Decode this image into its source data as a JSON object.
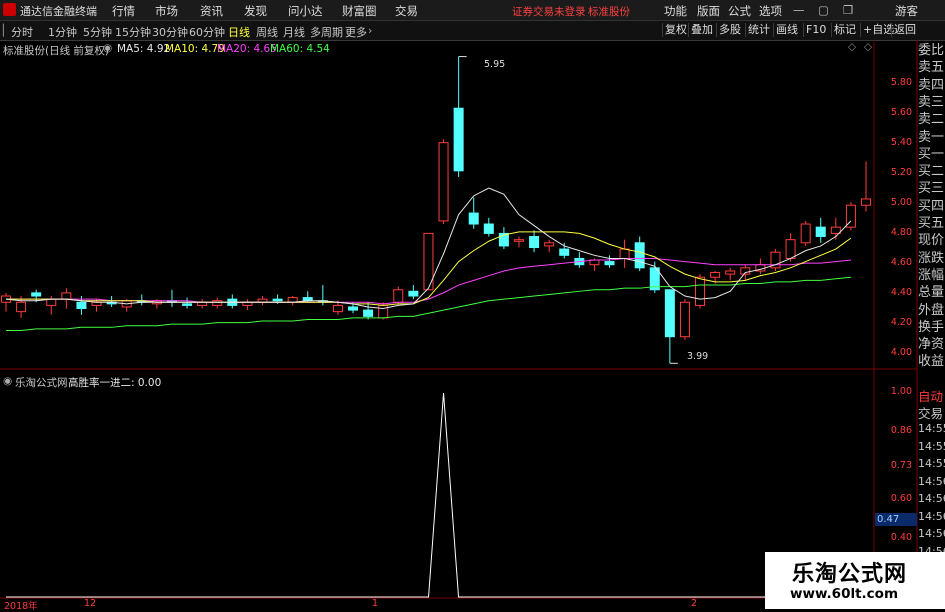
{
  "titlebar": {
    "app_name": "通达信金融终端",
    "menu": [
      "行情",
      "市场",
      "资讯",
      "发现",
      "问小达",
      "财富圈",
      "交易"
    ],
    "warning": "证券交易未登录",
    "stock_name": "标准股份",
    "right_menu": [
      "功能",
      "版面",
      "公式",
      "选项"
    ],
    "guest": "游客"
  },
  "periods": {
    "items": [
      "分时",
      "1分钟",
      "5分钟",
      "15分钟",
      "30分钟",
      "60分钟",
      "日线",
      "周线",
      "月线",
      "多周期",
      "更多"
    ],
    "active": "日线"
  },
  "toolbar_right": [
    "复权",
    "叠加",
    "多股",
    "统计",
    "画线",
    "F10",
    "标记",
    "+自选",
    "返回"
  ],
  "main_chart": {
    "title": "标准股份(日线 前复权)",
    "ma": [
      {
        "label": "MA5: 4.92",
        "color": "#e8e8e8"
      },
      {
        "label": "MA10: 4.79",
        "color": "#ffff40"
      },
      {
        "label": "MA20: 4.65",
        "color": "#ff40ff"
      },
      {
        "label": "MA60: 4.54",
        "color": "#40ff40"
      }
    ],
    "y_ticks": [
      "5.80",
      "5.60",
      "5.40",
      "5.20",
      "5.00",
      "4.80",
      "4.60",
      "4.40",
      "4.20",
      "4.00"
    ],
    "high_label": "5.95",
    "low_label": "3.99"
  },
  "indicator": {
    "title": "乐淘公式网",
    "name_value": "高胜率一进二: 0.00",
    "y_ticks": [
      "1.00",
      "0.86",
      "0.73",
      "0.60",
      "0.47",
      "0.40"
    ],
    "current_value": "0.47"
  },
  "dates": [
    "2018年",
    "12",
    "1",
    "2"
  ],
  "side_panel": {
    "labels": [
      "委比",
      "卖五",
      "卖四",
      "卖三",
      "卖二",
      "卖一",
      "买一",
      "买二",
      "买三",
      "买四",
      "买五",
      "现价",
      "涨跌",
      "涨幅",
      "总量",
      "外盘",
      "换手",
      "净资",
      "收益"
    ],
    "auto": "自动",
    "trade": "交易",
    "times": [
      "14:55",
      "14:55",
      "14:55",
      "14:56",
      "14:56",
      "14:56",
      "14:56",
      "14:56"
    ]
  },
  "watermark": {
    "line1": "乐淘公式网",
    "line2": "www.60lt.com"
  },
  "chart_data": [
    {
      "type": "candlestick",
      "title": "标准股份(日线 前复权)",
      "ylim": [
        3.96,
        5.96
      ],
      "candles": [
        {
          "o": 4.38,
          "h": 4.44,
          "l": 4.32,
          "c": 4.42
        },
        {
          "o": 4.32,
          "h": 4.42,
          "l": 4.28,
          "c": 4.38
        },
        {
          "o": 4.44,
          "h": 4.46,
          "l": 4.38,
          "c": 4.42
        },
        {
          "o": 4.36,
          "h": 4.42,
          "l": 4.3,
          "c": 4.4
        },
        {
          "o": 4.4,
          "h": 4.47,
          "l": 4.34,
          "c": 4.44
        },
        {
          "o": 4.38,
          "h": 4.42,
          "l": 4.3,
          "c": 4.34
        },
        {
          "o": 4.36,
          "h": 4.4,
          "l": 4.32,
          "c": 4.38
        },
        {
          "o": 4.38,
          "h": 4.42,
          "l": 4.35,
          "c": 4.37
        },
        {
          "o": 4.35,
          "h": 4.4,
          "l": 4.32,
          "c": 4.39
        },
        {
          "o": 4.39,
          "h": 4.43,
          "l": 4.36,
          "c": 4.38
        },
        {
          "o": 4.37,
          "h": 4.4,
          "l": 4.34,
          "c": 4.39
        },
        {
          "o": 4.39,
          "h": 4.46,
          "l": 4.35,
          "c": 4.38
        },
        {
          "o": 4.37,
          "h": 4.41,
          "l": 4.34,
          "c": 4.36
        },
        {
          "o": 4.36,
          "h": 4.4,
          "l": 4.34,
          "c": 4.38
        },
        {
          "o": 4.36,
          "h": 4.41,
          "l": 4.34,
          "c": 4.39
        },
        {
          "o": 4.4,
          "h": 4.43,
          "l": 4.34,
          "c": 4.36
        },
        {
          "o": 4.36,
          "h": 4.4,
          "l": 4.33,
          "c": 4.38
        },
        {
          "o": 4.38,
          "h": 4.42,
          "l": 4.36,
          "c": 4.4
        },
        {
          "o": 4.4,
          "h": 4.43,
          "l": 4.37,
          "c": 4.39
        },
        {
          "o": 4.38,
          "h": 4.42,
          "l": 4.36,
          "c": 4.41
        },
        {
          "o": 4.41,
          "h": 4.45,
          "l": 4.38,
          "c": 4.39
        },
        {
          "o": 4.39,
          "h": 4.49,
          "l": 4.36,
          "c": 4.38
        },
        {
          "o": 4.32,
          "h": 4.39,
          "l": 4.3,
          "c": 4.36
        },
        {
          "o": 4.35,
          "h": 4.38,
          "l": 4.31,
          "c": 4.33
        },
        {
          "o": 4.33,
          "h": 4.38,
          "l": 4.27,
          "c": 4.29
        },
        {
          "o": 4.28,
          "h": 4.38,
          "l": 4.27,
          "c": 4.36
        },
        {
          "o": 4.38,
          "h": 4.48,
          "l": 4.36,
          "c": 4.46
        },
        {
          "o": 4.45,
          "h": 4.49,
          "l": 4.4,
          "c": 4.42
        },
        {
          "o": 4.46,
          "h": 4.82,
          "l": 4.46,
          "c": 4.82
        },
        {
          "o": 4.9,
          "h": 5.42,
          "l": 4.88,
          "c": 5.4
        },
        {
          "o": 5.62,
          "h": 5.95,
          "l": 5.18,
          "c": 5.22
        },
        {
          "o": 4.95,
          "h": 5.05,
          "l": 4.85,
          "c": 4.88
        },
        {
          "o": 4.88,
          "h": 4.92,
          "l": 4.8,
          "c": 4.82
        },
        {
          "o": 4.82,
          "h": 4.86,
          "l": 4.72,
          "c": 4.74
        },
        {
          "o": 4.77,
          "h": 4.8,
          "l": 4.73,
          "c": 4.78
        },
        {
          "o": 4.8,
          "h": 4.84,
          "l": 4.7,
          "c": 4.73
        },
        {
          "o": 4.74,
          "h": 4.78,
          "l": 4.7,
          "c": 4.76
        },
        {
          "o": 4.72,
          "h": 4.76,
          "l": 4.66,
          "c": 4.68
        },
        {
          "o": 4.66,
          "h": 4.7,
          "l": 4.6,
          "c": 4.62
        },
        {
          "o": 4.62,
          "h": 4.66,
          "l": 4.58,
          "c": 4.65
        },
        {
          "o": 4.64,
          "h": 4.68,
          "l": 4.6,
          "c": 4.62
        },
        {
          "o": 4.66,
          "h": 4.78,
          "l": 4.6,
          "c": 4.72
        },
        {
          "o": 4.76,
          "h": 4.8,
          "l": 4.58,
          "c": 4.6
        },
        {
          "o": 4.6,
          "h": 4.64,
          "l": 4.44,
          "c": 4.46
        },
        {
          "o": 4.46,
          "h": 4.46,
          "l": 3.99,
          "c": 4.16
        },
        {
          "o": 4.16,
          "h": 4.4,
          "l": 4.14,
          "c": 4.38
        },
        {
          "o": 4.36,
          "h": 4.56,
          "l": 4.34,
          "c": 4.54
        },
        {
          "o": 4.54,
          "h": 4.58,
          "l": 4.5,
          "c": 4.57
        },
        {
          "o": 4.56,
          "h": 4.6,
          "l": 4.52,
          "c": 4.58
        },
        {
          "o": 4.56,
          "h": 4.62,
          "l": 4.52,
          "c": 4.6
        },
        {
          "o": 4.58,
          "h": 4.66,
          "l": 4.56,
          "c": 4.62
        },
        {
          "o": 4.6,
          "h": 4.72,
          "l": 4.58,
          "c": 4.7
        },
        {
          "o": 4.66,
          "h": 4.82,
          "l": 4.64,
          "c": 4.78
        },
        {
          "o": 4.76,
          "h": 4.9,
          "l": 4.74,
          "c": 4.88
        },
        {
          "o": 4.86,
          "h": 4.92,
          "l": 4.76,
          "c": 4.8
        },
        {
          "o": 4.82,
          "h": 4.92,
          "l": 4.78,
          "c": 4.86
        },
        {
          "o": 4.86,
          "h": 5.02,
          "l": 4.84,
          "c": 5.0
        },
        {
          "o": 5.0,
          "h": 5.28,
          "l": 4.96,
          "c": 5.04
        }
      ],
      "ma5": [
        4.4,
        4.39,
        4.39,
        4.4,
        4.4,
        4.39,
        4.38,
        4.38,
        4.37,
        4.38,
        4.38,
        4.38,
        4.38,
        4.38,
        4.38,
        4.38,
        4.38,
        4.38,
        4.38,
        4.38,
        4.39,
        4.39,
        4.38,
        4.37,
        4.35,
        4.34,
        4.36,
        4.37,
        4.47,
        4.69,
        4.94,
        5.06,
        5.11,
        5.07,
        4.94,
        4.87,
        4.8,
        4.74,
        4.71,
        4.68,
        4.66,
        4.66,
        4.64,
        4.61,
        4.48,
        4.42,
        4.4,
        4.41,
        4.45,
        4.57,
        4.59,
        4.62,
        4.66,
        4.71,
        4.74,
        4.8,
        4.9
      ],
      "ma10": [
        4.4,
        4.4,
        4.4,
        4.4,
        4.4,
        4.39,
        4.39,
        4.39,
        4.39,
        4.39,
        4.38,
        4.38,
        4.38,
        4.38,
        4.38,
        4.38,
        4.38,
        4.38,
        4.38,
        4.38,
        4.38,
        4.38,
        4.38,
        4.37,
        4.37,
        4.36,
        4.37,
        4.37,
        4.41,
        4.52,
        4.64,
        4.71,
        4.77,
        4.81,
        4.83,
        4.83,
        4.83,
        4.83,
        4.82,
        4.79,
        4.75,
        4.72,
        4.7,
        4.67,
        4.61,
        4.56,
        4.53,
        4.51,
        4.51,
        4.52,
        4.55,
        4.57,
        4.6,
        4.64,
        4.68,
        4.72,
        4.79
      ],
      "ma20": [
        4.4,
        4.4,
        4.4,
        4.4,
        4.4,
        4.4,
        4.4,
        4.39,
        4.39,
        4.39,
        4.39,
        4.39,
        4.39,
        4.38,
        4.38,
        4.38,
        4.38,
        4.38,
        4.38,
        4.38,
        4.38,
        4.38,
        4.38,
        4.38,
        4.38,
        4.37,
        4.38,
        4.38,
        4.4,
        4.44,
        4.49,
        4.52,
        4.55,
        4.58,
        4.6,
        4.61,
        4.62,
        4.63,
        4.64,
        4.65,
        4.65,
        4.66,
        4.66,
        4.66,
        4.65,
        4.64,
        4.63,
        4.62,
        4.62,
        4.62,
        4.62,
        4.62,
        4.62,
        4.63,
        4.63,
        4.64,
        4.65
      ],
      "ma60": [
        4.2,
        4.2,
        4.21,
        4.21,
        4.21,
        4.22,
        4.22,
        4.22,
        4.23,
        4.23,
        4.23,
        4.24,
        4.24,
        4.24,
        4.25,
        4.25,
        4.25,
        4.26,
        4.26,
        4.26,
        4.27,
        4.27,
        4.27,
        4.28,
        4.28,
        4.28,
        4.29,
        4.29,
        4.31,
        4.33,
        4.35,
        4.37,
        4.39,
        4.4,
        4.41,
        4.42,
        4.43,
        4.44,
        4.45,
        4.46,
        4.46,
        4.47,
        4.47,
        4.48,
        4.48,
        4.48,
        4.49,
        4.49,
        4.49,
        4.5,
        4.5,
        4.51,
        4.51,
        4.52,
        4.52,
        4.53,
        4.54
      ]
    },
    {
      "type": "line",
      "title": "高胜率一进二",
      "ylim": [
        0.0,
        1.0
      ],
      "values": [
        0,
        0,
        0,
        0,
        0,
        0,
        0,
        0,
        0,
        0,
        0,
        0,
        0,
        0,
        0,
        0,
        0,
        0,
        0,
        0,
        0,
        0,
        0,
        0,
        0,
        0,
        0,
        0,
        0,
        1,
        0,
        0,
        0,
        0,
        0,
        0,
        0,
        0,
        0,
        0,
        0,
        0,
        0,
        0,
        0,
        0,
        0,
        0,
        0,
        0,
        0,
        0,
        0,
        0,
        0,
        0,
        0
      ]
    }
  ]
}
